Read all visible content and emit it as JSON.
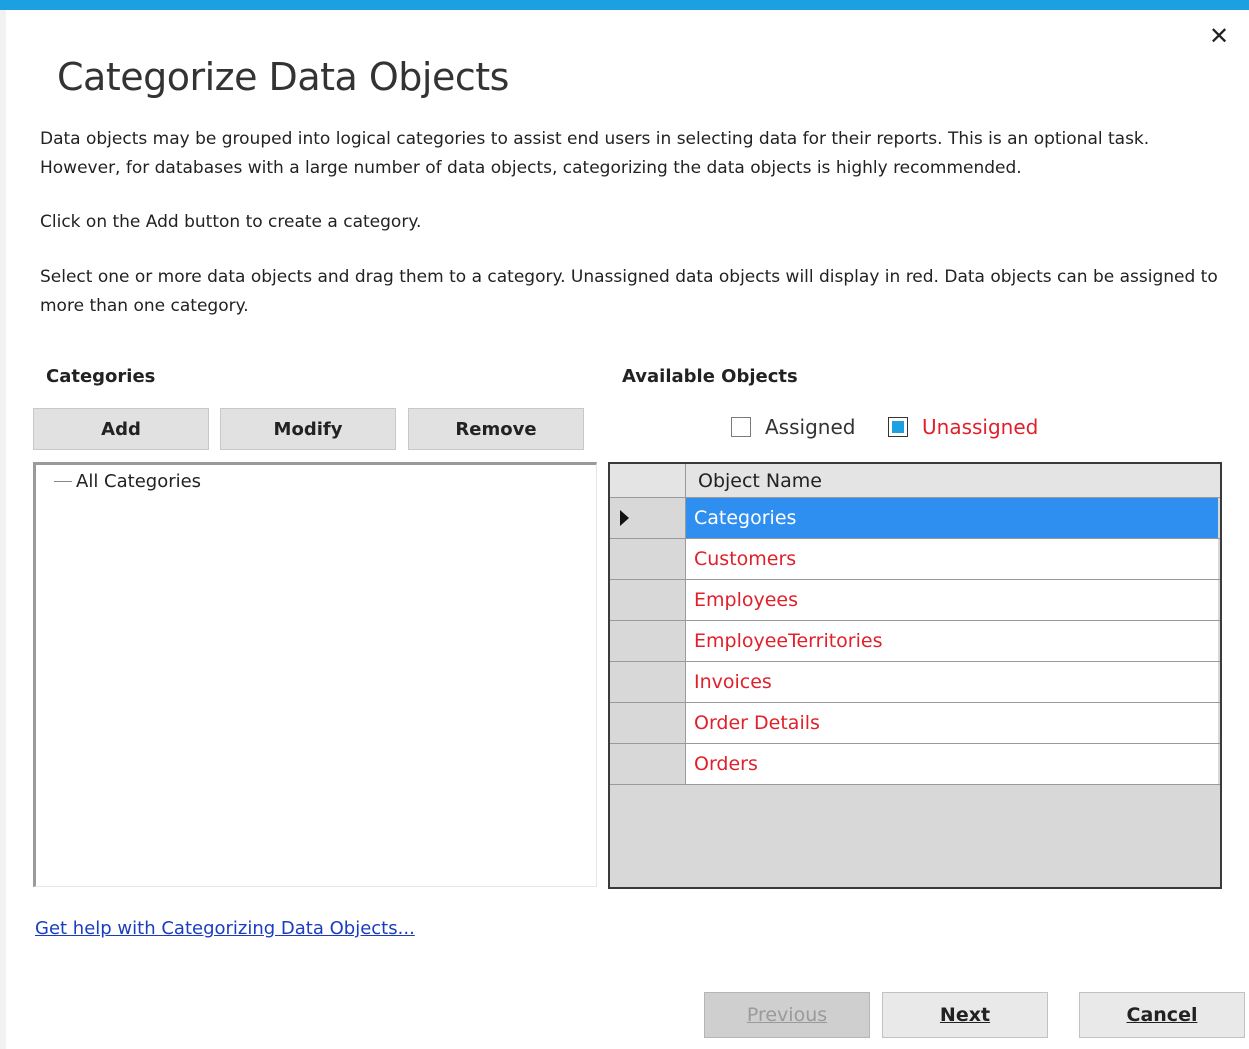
{
  "dialog": {
    "title": "Categorize Data Objects",
    "close_glyph": "✕",
    "paragraphs": [
      "Data objects may be grouped into logical categories to assist end users in selecting data for their reports. This is an optional task. However, for databases with a large number of data objects, categorizing the data objects is highly recommended.",
      "Click on the Add button to create a category.",
      "Select one or more data objects and drag them to a category. Unassigned data objects will display in red. Data objects can be assigned to more than one category."
    ]
  },
  "categories": {
    "label": "Categories",
    "buttons": {
      "add": "Add",
      "modify": "Modify",
      "remove": "Remove"
    },
    "tree": {
      "root": "All Categories"
    }
  },
  "available": {
    "label": "Available Objects",
    "filters": {
      "assigned": {
        "label": "Assigned",
        "checked": false
      },
      "unassigned": {
        "label": "Unassigned",
        "checked": true
      }
    },
    "grid": {
      "column": "Object Name",
      "rows": [
        "Categories",
        "Customers",
        "Employees",
        "EmployeeTerritories",
        "Invoices",
        "Order Details",
        "Orders"
      ],
      "selected_index": 0
    }
  },
  "help_link": "Get help with Categorizing Data Objects...",
  "nav": {
    "previous": "Previous",
    "next": "Next",
    "cancel": "Cancel"
  },
  "colors": {
    "accent": "#1ba1e2",
    "unassigned_text": "#e0202a",
    "selection": "#2f8ff0",
    "link": "#1a3dbf"
  }
}
